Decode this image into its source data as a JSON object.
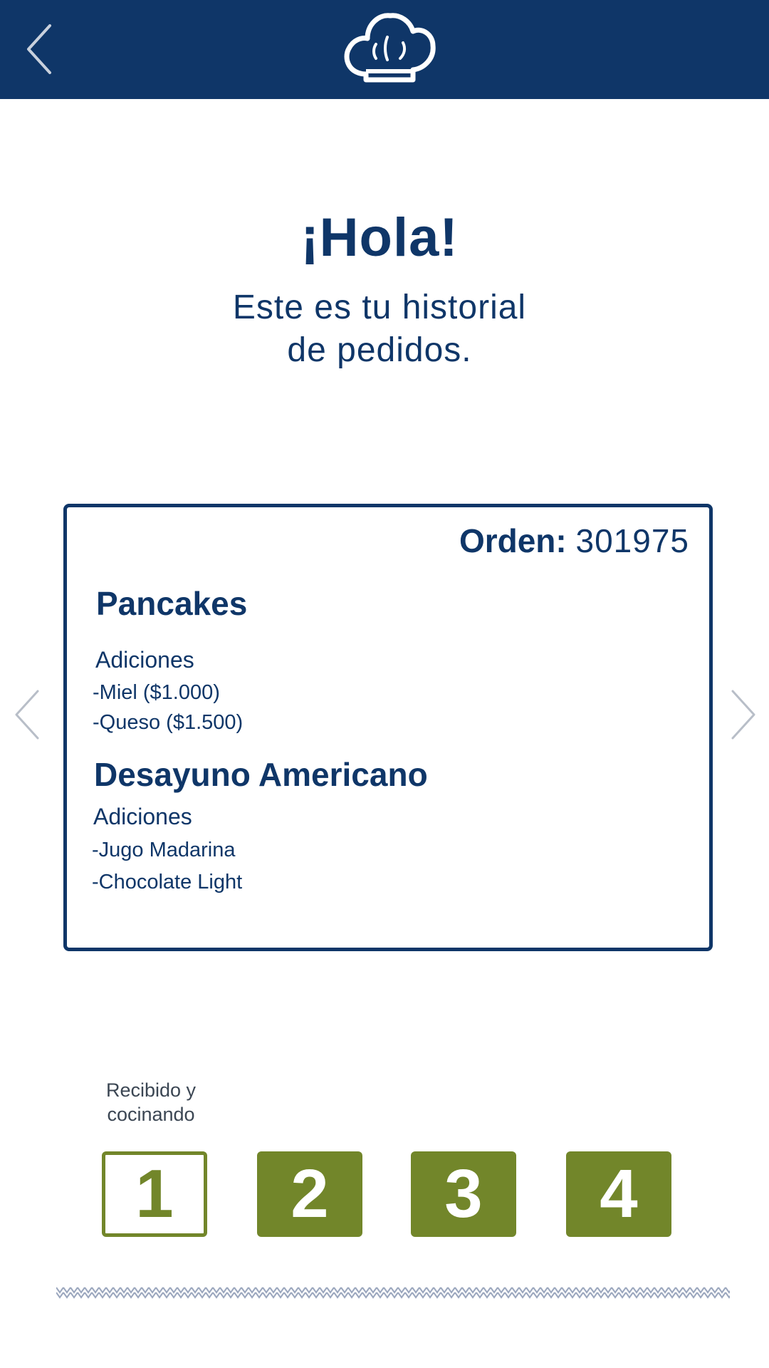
{
  "header": {
    "back_icon": "chevron-left-icon",
    "logo_icon": "chef-hat-icon",
    "background_color": "#0f3668"
  },
  "greeting": {
    "title": "¡Hola!",
    "subtitle_line1": "Este es tu historial",
    "subtitle_line2": "de pedidos."
  },
  "order_card": {
    "order_label": "Orden:",
    "order_number": "301975",
    "items": [
      {
        "name": "Pancakes",
        "additions_label": "Adiciones",
        "additions": [
          "-Miel ($1.000)",
          "-Queso ($1.500)"
        ]
      },
      {
        "name": "Desayuno Americano",
        "additions_label": "Adiciones",
        "additions": [
          "-Jugo Madarina",
          "-Chocolate Light"
        ]
      }
    ],
    "prev_icon": "chevron-left-icon",
    "next_icon": "chevron-right-icon"
  },
  "status": {
    "caption_line1": "Recibido y",
    "caption_line2": "cocinando",
    "steps": [
      "1",
      "2",
      "3",
      "4"
    ],
    "active_step": 1,
    "accent_color": "#72862a"
  },
  "colors": {
    "primary": "#0f3668",
    "accent": "#72862a",
    "text_muted": "#3b4653"
  }
}
